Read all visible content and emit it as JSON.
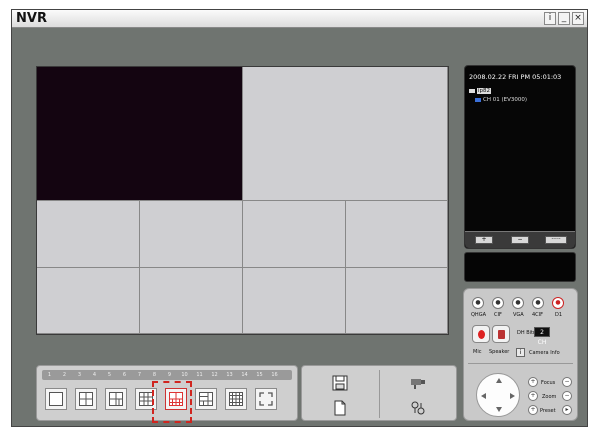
{
  "window": {
    "title": "NVR",
    "info_label": "i",
    "minimize_label": "_",
    "close_label": "×"
  },
  "device_panel": {
    "datetime": "2008.02.22 FRI PM 05:01:03",
    "tree_root": "ip82",
    "tree_child": "CH 01 (EV3000)",
    "buttons": [
      "+",
      "−",
      "·····"
    ]
  },
  "control_panel": {
    "resolution_labels": [
      "QHGA",
      "CIF",
      "VGA",
      "4CIF",
      "D1"
    ],
    "mic_label": "Mic",
    "speaker_label": "Speaker",
    "channel_label": "DH Bitr",
    "channel_value": "2 CH",
    "camera_info_label": "Camera Info",
    "info_button_label": "i",
    "focus_label": "Focus",
    "zoom_label": "Zoom",
    "preset_label": "Preset"
  },
  "layout_panel": {
    "channel_numbers": [
      "1",
      "2",
      "3",
      "4",
      "5",
      "6",
      "7",
      "8",
      "9",
      "10",
      "11",
      "12",
      "13",
      "14",
      "15",
      "16"
    ],
    "layouts": [
      "1x1",
      "2x2",
      "1+3",
      "3x3",
      "1+7",
      "1+9",
      "4x4",
      "fullscreen"
    ],
    "selected_layout": "1+7"
  },
  "colors": {
    "window_bg": "#6f7470",
    "video_empty": "#cfcfd2",
    "video_active": "#140511",
    "selection": "#d0251f"
  }
}
